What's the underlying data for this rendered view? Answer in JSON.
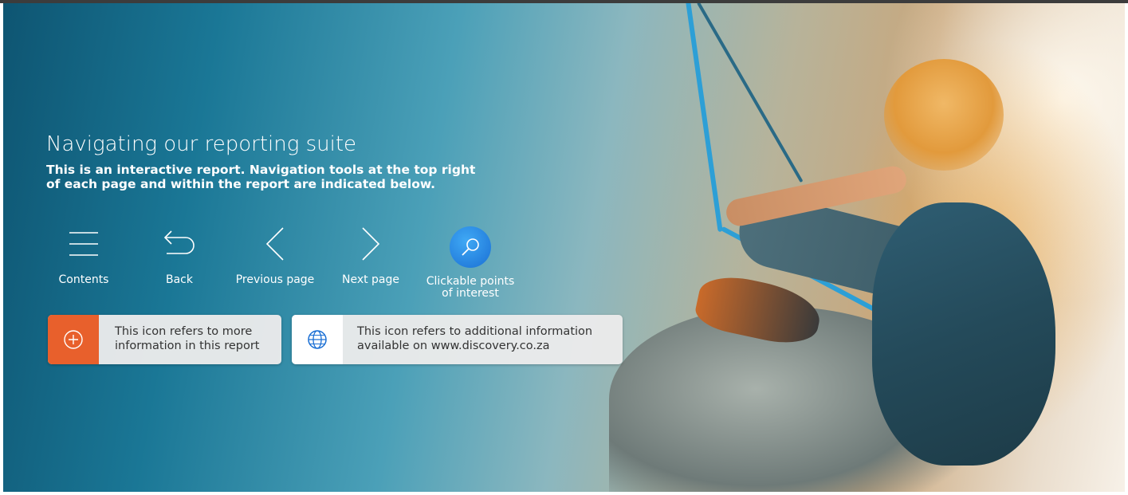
{
  "page": {
    "title": "Navigating our reporting suite",
    "subtitle_line1": "This is an interactive report. Navigation tools at the top right",
    "subtitle_line2": "of each page and within the report are indicated below."
  },
  "nav": [
    {
      "label": "Contents",
      "icon": "hamburger-menu-icon"
    },
    {
      "label": "Back",
      "icon": "back-arrow-icon"
    },
    {
      "label": "Previous page",
      "icon": "chevron-left-icon"
    },
    {
      "label": "Next page",
      "icon": "chevron-right-icon"
    },
    {
      "label_line1": "Clickable points",
      "label_line2": "of interest",
      "icon": "magnifier-icon"
    }
  ],
  "cards": [
    {
      "icon": "plus-circle-icon",
      "line1": "This icon refers to more",
      "line2": "information in this report",
      "accent": "#e8602c"
    },
    {
      "icon": "globe-icon",
      "line1": "This icon refers to additional information",
      "line2": "available on www.discovery.co.za",
      "accent": "#1a6fd4"
    }
  ],
  "colors": {
    "orange_accent": "#e8602c",
    "blue_accent": "#1a6fd4",
    "text_white": "#ffffff",
    "card_bg": "#ebebeb",
    "card_text": "#333333"
  }
}
